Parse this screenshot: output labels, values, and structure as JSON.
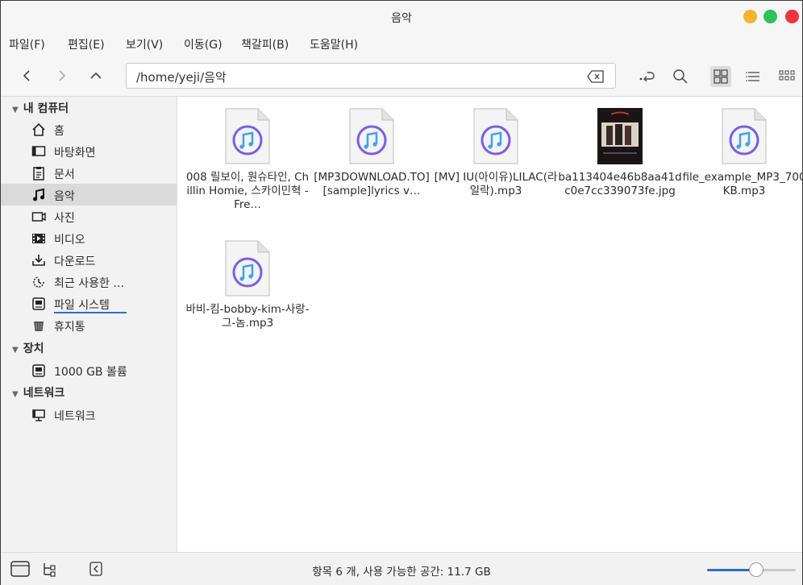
{
  "window": {
    "title": "음악",
    "controls": {
      "minimize_color": "#f6b32b",
      "maximize_color": "#2ec25b",
      "close_color": "#f2333b"
    }
  },
  "menubar": {
    "items": [
      "파일(F)",
      "편집(E)",
      "보기(V)",
      "이동(G)",
      "책갈피(B)",
      "도움말(H)"
    ]
  },
  "toolbar": {
    "back_icon": "chevron-left-icon",
    "forward_icon": "chevron-right-icon",
    "up_icon": "chevron-up-icon",
    "location": "/home/yeji/음악",
    "clear_icon": "backspace-icon",
    "go_icon": "go-icon",
    "search_icon": "search-icon",
    "view_icons_icon": "grid-view-icon",
    "view_list_icon": "list-view-icon",
    "view_compact_icon": "compact-view-icon",
    "active_view": "icons"
  },
  "sidebar": {
    "sections": [
      {
        "title": "내 컴퓨터",
        "items": [
          {
            "label": "홈",
            "icon": "home-icon"
          },
          {
            "label": "바탕화면",
            "icon": "desktop-icon"
          },
          {
            "label": "문서",
            "icon": "document-icon"
          },
          {
            "label": "음악",
            "icon": "music-icon",
            "selected": true
          },
          {
            "label": "사진",
            "icon": "pictures-icon"
          },
          {
            "label": "비디오",
            "icon": "video-icon"
          },
          {
            "label": "다운로드",
            "icon": "download-icon"
          },
          {
            "label": "최근 사용한 …",
            "icon": "recent-icon"
          },
          {
            "label": "파일 시스템",
            "icon": "drive-icon",
            "usage_fraction": 0.5
          },
          {
            "label": "휴지통",
            "icon": "trash-icon"
          }
        ]
      },
      {
        "title": "장치",
        "items": [
          {
            "label": "1000 GB 볼륨",
            "icon": "drive-icon"
          }
        ]
      },
      {
        "title": "네트워크",
        "items": [
          {
            "label": "네트워크",
            "icon": "network-icon"
          }
        ]
      }
    ]
  },
  "files": [
    {
      "label": "008 릴보이, 원슈타인, Chillin Homie, 스카이민혁 - Fre…",
      "type": "audio"
    },
    {
      "label": "[MP3DOWNLOAD.TO] [sample]lyrics v…",
      "type": "audio"
    },
    {
      "label": "[MV] IU(아이유)LILAC(라일락).mp3",
      "type": "audio"
    },
    {
      "label": "ba113404e46b8aa41dc0e7cc339073fe.jpg",
      "type": "image"
    },
    {
      "label": "file_example_MP3_700KB.mp3",
      "type": "audio"
    },
    {
      "label": "바비-킴-bobby-kim-사랑-그-놈.mp3",
      "type": "audio"
    }
  ],
  "statusbar": {
    "text": "항목 6 개, 사용 가능한 공간: 11.7 GB",
    "places_icon": "folder-icon",
    "tree_icon": "tree-view-icon",
    "toggle_icon": "sidebar-toggle-icon",
    "zoom_fraction": 0.55
  },
  "colors": {
    "accent": "#2f6bd4",
    "selected_bg": "#dadada"
  }
}
